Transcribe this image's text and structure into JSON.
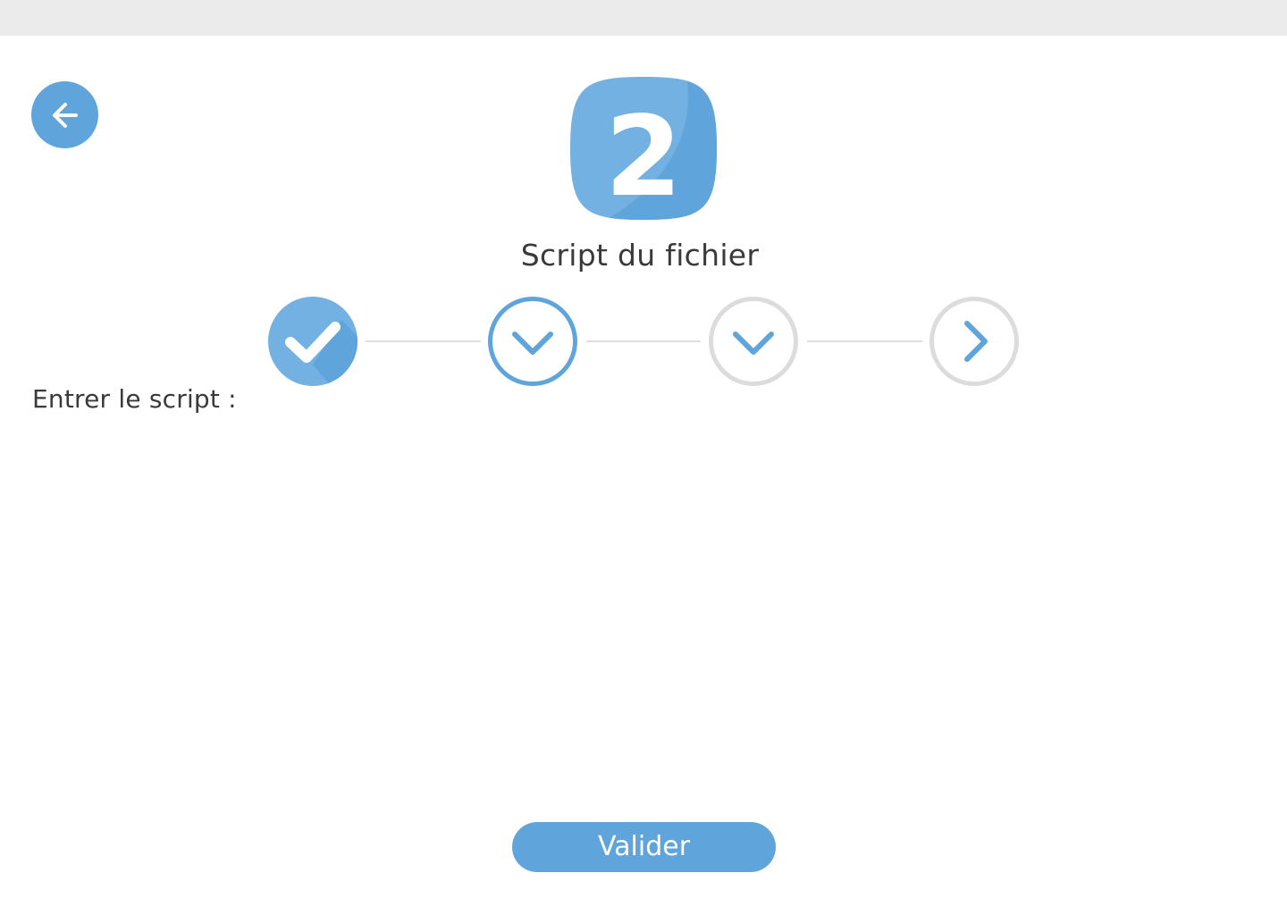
{
  "header": {
    "back_icon": "arrow-left-icon",
    "step_number": "2",
    "title": "Script du fichier"
  },
  "stepper": {
    "steps": [
      {
        "state": "completed",
        "icon": "checkmark-icon"
      },
      {
        "state": "current",
        "icon": "chevron-down-icon"
      },
      {
        "state": "upcoming",
        "icon": "chevron-down-icon"
      },
      {
        "state": "upcoming",
        "icon": "chevron-right-icon"
      }
    ]
  },
  "form": {
    "script_label": "Entrer le script :",
    "script_value": "",
    "submit_label": "Valider"
  },
  "colors": {
    "accent": "#5fa5dc",
    "accent_light": "#72b1e2",
    "inactive": "#dcdcdc",
    "text": "#3a3a3a",
    "top_bar": "#ebebeb"
  }
}
